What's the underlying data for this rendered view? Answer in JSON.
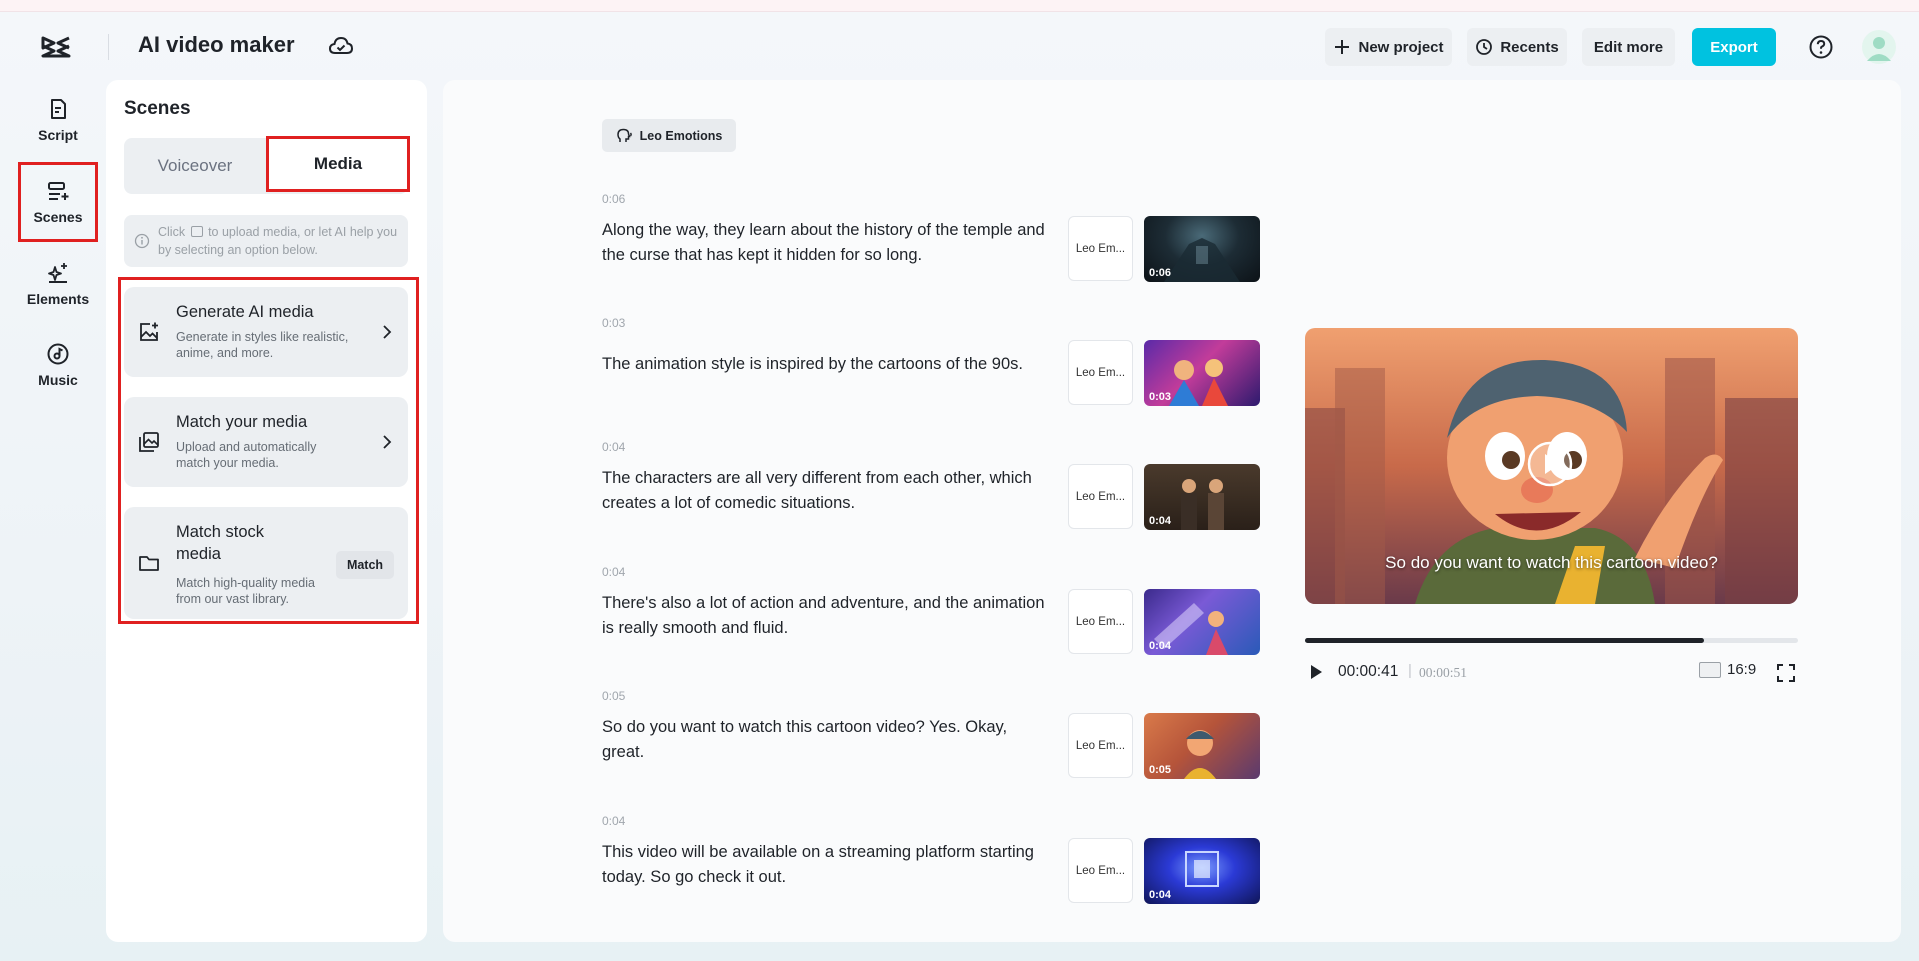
{
  "header": {
    "app_title": "AI video maker",
    "buttons": {
      "new_project": "New project",
      "recents": "Recents",
      "edit_more": "Edit more",
      "export": "Export"
    }
  },
  "colors": {
    "accent": "#00c2e0",
    "highlight": "#e02020"
  },
  "nav": {
    "script": "Script",
    "scenes": "Scenes",
    "elements": "Elements",
    "music": "Music"
  },
  "panel": {
    "title": "Scenes",
    "tabs": {
      "voiceover": "Voiceover",
      "media": "Media"
    },
    "info": {
      "before_icon": "Click",
      "after_icon": "to upload media, or let AI help you by selecting an option below."
    },
    "options": [
      {
        "title": "Generate AI media",
        "desc": "Generate in styles like realistic, anime, and more."
      },
      {
        "title": "Match your media",
        "desc": "Upload and automatically match your media."
      },
      {
        "title": "Match stock media",
        "desc": "Match high-quality media from our vast library.",
        "action": "Match"
      }
    ]
  },
  "main": {
    "voice_tag": "Leo Emotions",
    "scenes": [
      {
        "duration": "0:06",
        "text": "Along the way, they learn about the history of the temple and the curse that has kept it hidden for so long.",
        "voice": "Leo Em...",
        "thumb_time": "0:06"
      },
      {
        "duration": "0:03",
        "text": "The animation style is inspired by the cartoons of the 90s.",
        "voice": "Leo Em...",
        "thumb_time": "0:03"
      },
      {
        "duration": "0:04",
        "text": "The characters are all very different from each other, which creates a lot of comedic situations.",
        "voice": "Leo Em...",
        "thumb_time": "0:04"
      },
      {
        "duration": "0:04",
        "text": "There's also a lot of action and adventure, and the animation is really smooth and fluid.",
        "voice": "Leo Em...",
        "thumb_time": "0:04"
      },
      {
        "duration": "0:05",
        "text": "So do you want to watch this cartoon video? Yes. Okay, great.",
        "voice": "Leo Em...",
        "thumb_time": "0:05"
      },
      {
        "duration": "0:04",
        "text": "This video will be available on a streaming platform starting today. So go check it out.",
        "voice": "Leo Em...",
        "thumb_time": "0:04"
      }
    ]
  },
  "preview": {
    "caption": "So do you want to watch this cartoon video?",
    "current_time": "00:00:41",
    "separator": "|",
    "total_time": "00:00:51",
    "progress_percent": 81,
    "aspect_ratio": "16:9"
  }
}
